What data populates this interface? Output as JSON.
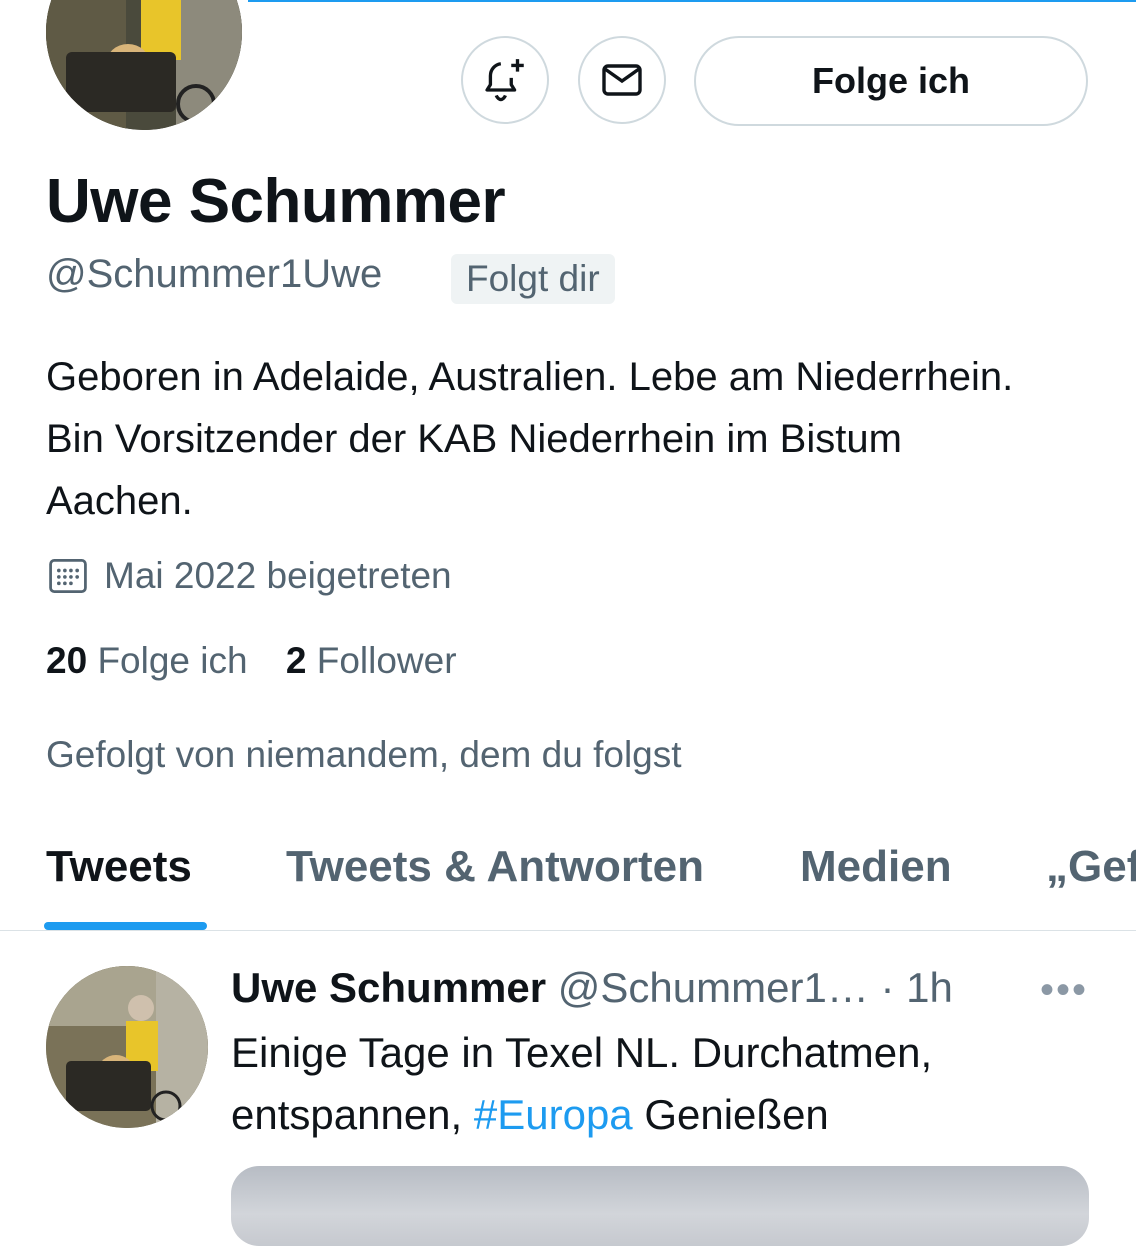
{
  "colors": {
    "accent": "#1d9bf0",
    "text": "#0f1419",
    "secondary": "#536471",
    "border": "#cfd9de"
  },
  "header": {
    "avatar_icon": "profile-photo",
    "notify_icon": "bell-plus-icon",
    "message_icon": "envelope-icon",
    "follow_button_label": "Folge ich"
  },
  "profile": {
    "name": "Uwe Schummer",
    "handle": "@Schummer1Uwe",
    "follows_you": "Folgt dir",
    "bio": "Geboren in Adelaide, Australien. Lebe am Niederrhein. Bin Vorsitzender der KAB Niederrhein im Bistum Aachen.",
    "joined_icon": "calendar-icon",
    "joined": "Mai 2022 beigetreten",
    "following_count": "20",
    "following_label": "Folge ich",
    "followers_count": "2",
    "followers_label": "Follower",
    "followed_by": "Gefolgt von niemandem, dem du folgst"
  },
  "tabs": [
    {
      "label": "Tweets",
      "active": true
    },
    {
      "label": "Tweets & Antworten",
      "active": false
    },
    {
      "label": "Medien",
      "active": false
    },
    {
      "label": "„Gef",
      "active": false
    }
  ],
  "tweet": {
    "author": "Uwe Schummer",
    "handle": "@Schummer1…",
    "separator": "·",
    "time": "1h",
    "more_icon": "more-dots-icon",
    "text_before": "Einige Tage in Texel NL. Durchatmen, entspannen, ",
    "hashtag": "#Europa",
    "text_after": " Genießen"
  }
}
